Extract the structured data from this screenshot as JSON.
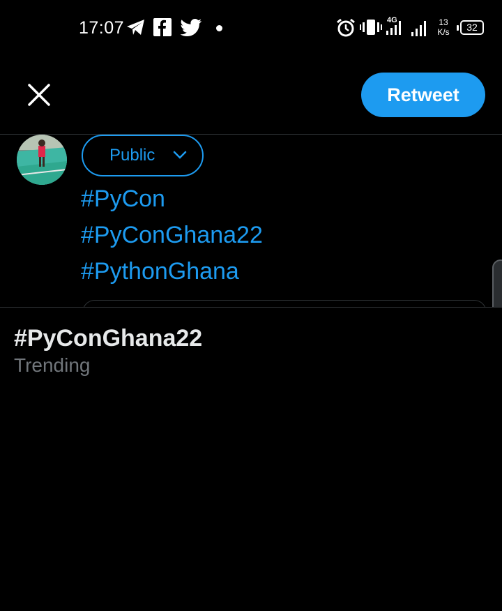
{
  "status_bar": {
    "time": "17:07",
    "notification_icons": [
      "telegram-icon",
      "facebook-icon",
      "twitter-icon",
      "dot-icon"
    ],
    "system_icons": [
      "alarm-icon",
      "vibrate-icon",
      "signal-4g-icon",
      "signal-bars-icon"
    ],
    "network_badge": "4G",
    "speed_value": "13",
    "speed_unit": "K/s",
    "battery": "32"
  },
  "header": {
    "close_icon": "close-icon",
    "retweet_label": "Retweet",
    "accent_color": "#1d9bf0"
  },
  "composer": {
    "avatar_icon": "profile-photo",
    "audience_label": "Public",
    "hashtags": [
      "#PyCon",
      "#PyConGhana22",
      "#PythonGhana"
    ]
  },
  "suggestions": [
    {
      "title": "#PyConGhana22",
      "subtitle": "Trending"
    }
  ]
}
